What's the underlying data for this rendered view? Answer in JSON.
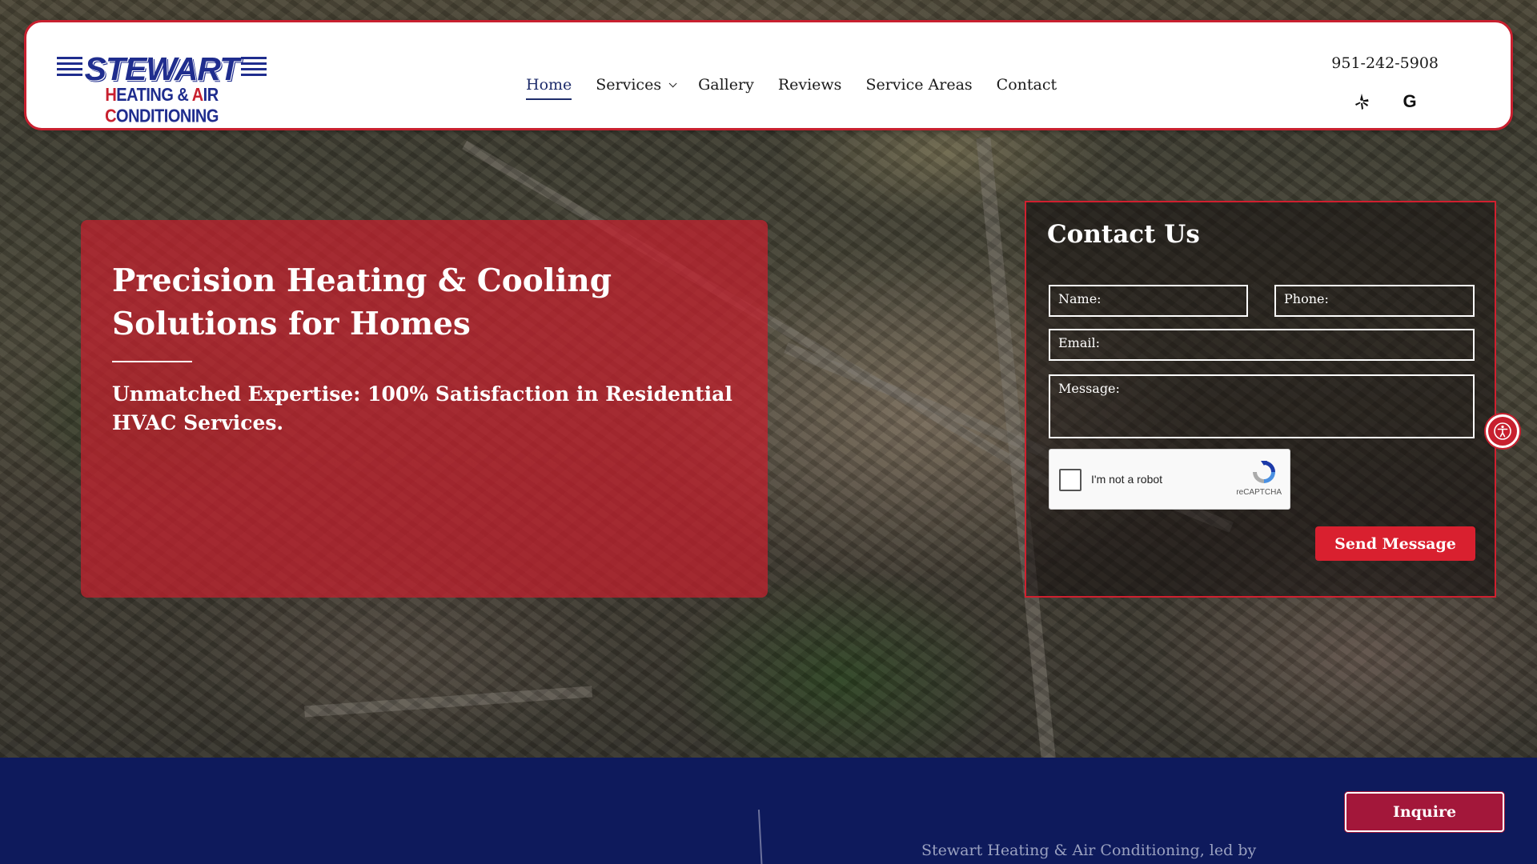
{
  "brand": {
    "logo_word": "STEWART",
    "logo_sub_1": "H",
    "logo_sub_2": "EATING & ",
    "logo_sub_3": "A",
    "logo_sub_4": "IR ",
    "logo_sub_5": "C",
    "logo_sub_6": "ONDITIONING",
    "colors": {
      "primary_blue": "#1f2d8e",
      "accent_red": "#c8202f",
      "band_navy": "#0e1a5c"
    }
  },
  "nav": {
    "items": [
      {
        "label": "Home",
        "active": true
      },
      {
        "label": "Services",
        "has_dropdown": true
      },
      {
        "label": "Gallery"
      },
      {
        "label": "Reviews"
      },
      {
        "label": "Service Areas"
      },
      {
        "label": "Contact"
      }
    ]
  },
  "header": {
    "phone": "951-242-5908",
    "social": [
      {
        "icon": "yelp-icon",
        "glyph": "✱"
      },
      {
        "icon": "google-icon",
        "glyph": "G"
      }
    ]
  },
  "hero": {
    "title": "Precision Heating & Cooling Solutions for Homes",
    "subtitle": "Unmatched Expertise: 100% Satisfaction in Residential HVAC Services."
  },
  "contact_form": {
    "title": "Contact Us",
    "name_placeholder": "Name:",
    "phone_placeholder": "Phone:",
    "email_placeholder": "Email:",
    "message_placeholder": "Message:",
    "captcha_label": "I'm not a robot",
    "captcha_brand": "reCAPTCHA",
    "submit_label": "Send Message"
  },
  "footer_band": {
    "text": "Stewart Heating & Air Conditioning, led by",
    "inquire_label": "Inquire"
  }
}
